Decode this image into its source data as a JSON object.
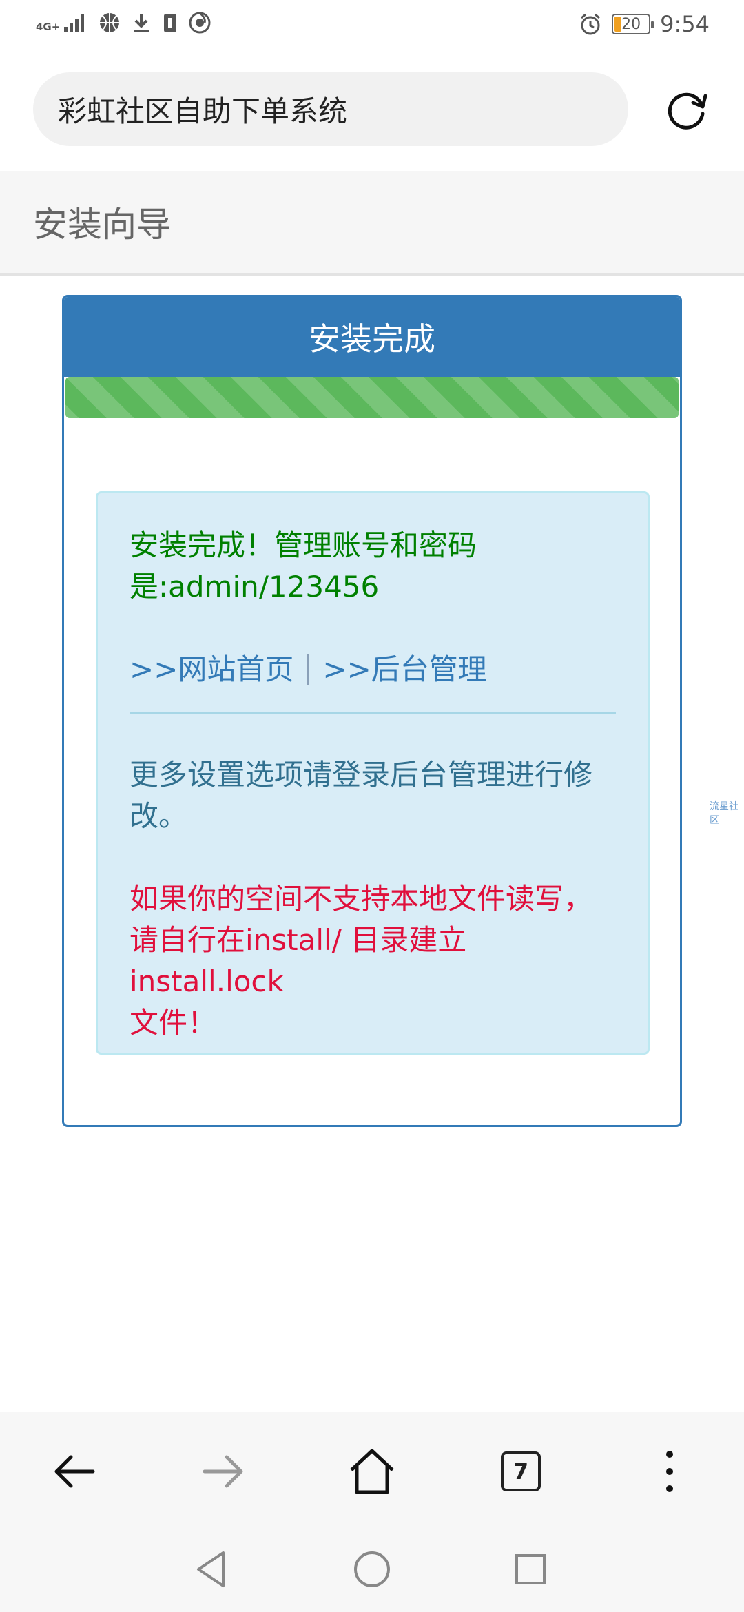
{
  "status_bar": {
    "network_label": "4G+",
    "time": "9:54",
    "battery_level": "20",
    "icons": [
      "signal-icon",
      "basketball-icon",
      "download-icon",
      "sim-icon",
      "browser-icon",
      "alarm-icon"
    ]
  },
  "address_bar": {
    "title": "彩虹社区自助下单系统",
    "reload_icon": "reload-icon"
  },
  "page": {
    "header_title": "安装向导",
    "panel_title": "安装完成",
    "progress_percent": 100,
    "success_message_line1": "安装完成！管理账号和密码",
    "success_message_line2": "是:admin/123456",
    "link_home": ">>网站首页",
    "link_admin": ">>后台管理",
    "info_line1": "更多设置选项请登录后台管理进行修",
    "info_line2": "改。",
    "warning_line1": "如果你的空间不支持本地文件读写，",
    "warning_line2": "请自行在install/ 目录建立 install.lock",
    "warning_line3": "文件！",
    "side_tag": "流星社区"
  },
  "toolbar": {
    "tab_count": "7",
    "buttons": [
      "back-icon",
      "forward-icon",
      "home-icon",
      "tabs-icon",
      "more-icon"
    ]
  },
  "colors": {
    "primary": "#337ab7",
    "success_bar": "#5cb85c",
    "alert_bg": "#d9edf7",
    "success_text": "#008000",
    "warning_text": "#e0103c"
  }
}
